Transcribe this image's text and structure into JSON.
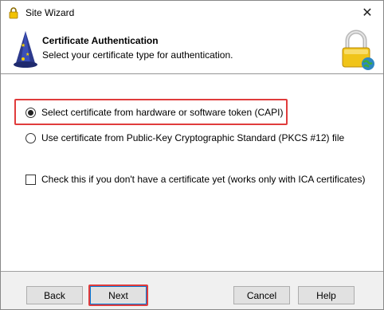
{
  "window": {
    "title": "Site Wizard",
    "close_glyph": "✕",
    "icon": "padlock-icon"
  },
  "header": {
    "title": "Certificate Authentication",
    "subtitle": "Select your certificate type for authentication.",
    "left_icon": "wizard-hat-icon",
    "right_icon": "lock-globe-icon"
  },
  "options": {
    "capi": {
      "label": "Select certificate from hardware or software token (CAPI)",
      "selected": true
    },
    "pkcs12": {
      "label": "Use certificate from Public-Key Cryptographic Standard (PKCS #12) file",
      "selected": false
    },
    "no_cert": {
      "label": "Check this if you don't have a certificate yet (works only with ICA certificates)",
      "checked": false
    }
  },
  "buttons": {
    "back": "Back",
    "next": "Next",
    "cancel": "Cancel",
    "help": "Help"
  },
  "colors": {
    "highlight": "#e03c3c",
    "default_button_border": "#0078d7",
    "dialog_bg": "#f0f0f0"
  }
}
